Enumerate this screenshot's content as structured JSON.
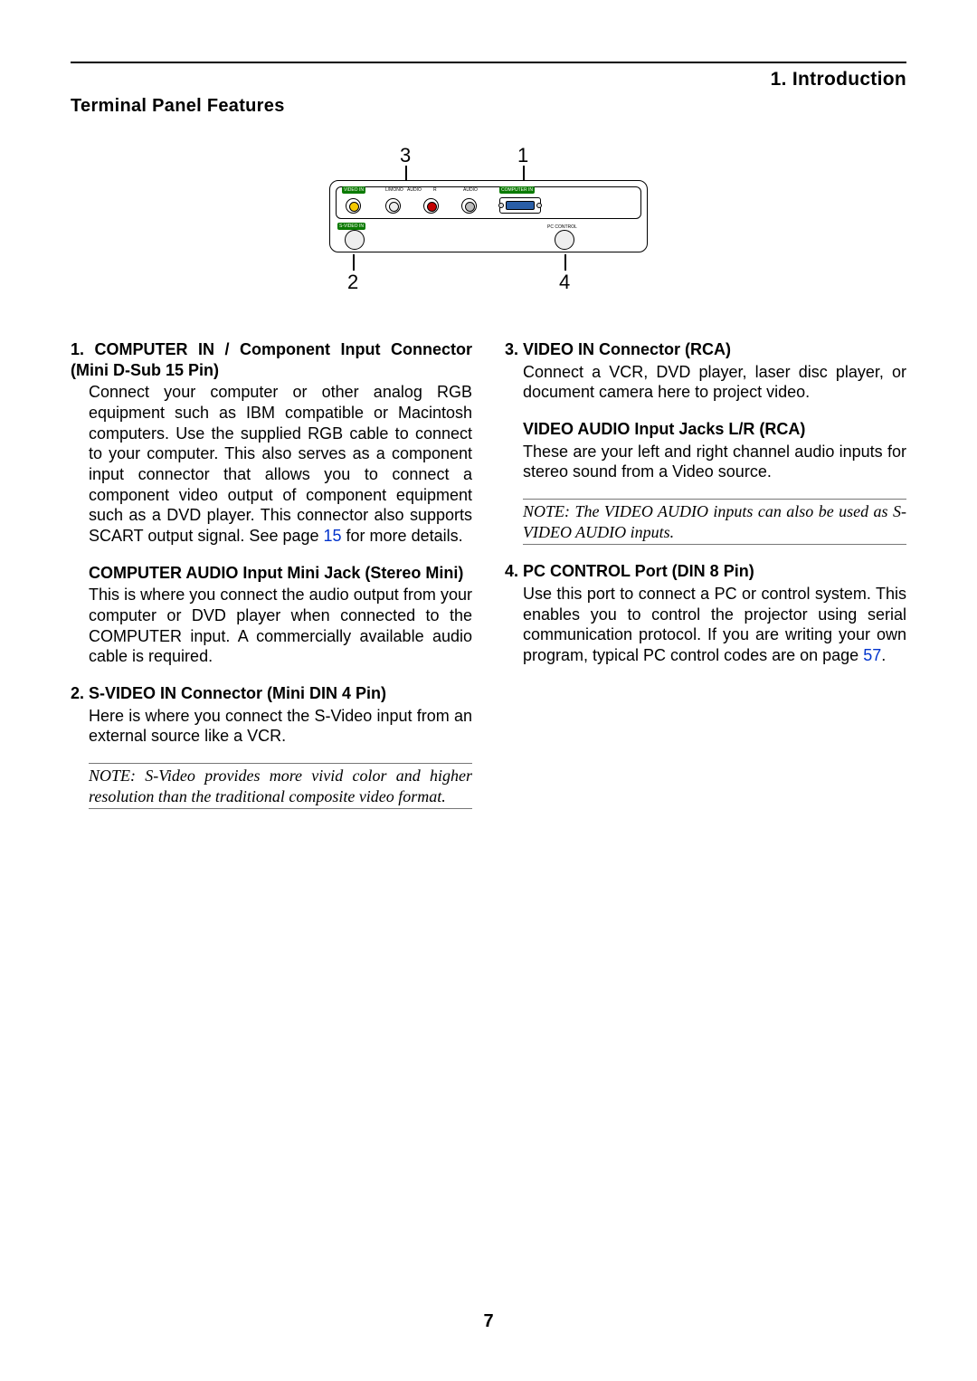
{
  "header": {
    "chapter": "1. Introduction",
    "section": "Terminal Panel Features"
  },
  "page_number": "7",
  "diagram": {
    "callouts": {
      "n1": "1",
      "n2": "2",
      "n3": "3",
      "n4": "4"
    },
    "labels": {
      "video_in": "VIDEO IN",
      "audio": "AUDIO",
      "lmono": "L/MONO",
      "r": "R",
      "audio2": "AUDIO",
      "computer_in": "COMPUTER IN",
      "s_video_in": "S-VIDEO IN",
      "pc_control": "PC CONTROL"
    }
  },
  "col1": {
    "t1": "1. COMPUTER IN / Component Input Connector (Mini D-Sub 15 Pin)",
    "p1a": "Connect your computer or other analog RGB equipment such as IBM compatible or Macintosh computers. Use the supplied RGB cable to connect to your computer. This also serves as a component input connector that allows you to connect a component video output of component equipment such as a DVD player. This connector also supports SCART output signal. See page ",
    "p1_link": "15",
    "p1b": " for more details.",
    "t2": "COMPUTER AUDIO Input Mini Jack (Stereo Mini)",
    "p2": "This is where you connect the audio output from your computer or DVD player when connected to the COMPUTER input. A commercially available audio cable is required.",
    "t3": "2. S-VIDEO IN Connector (Mini DIN 4 Pin)",
    "p3": "Here is where you connect the S-Video input from an external source like a VCR.",
    "note1": "NOTE: S-Video provides more vivid color and higher resolution than the traditional composite video format."
  },
  "col2": {
    "t1": "3. VIDEO IN Connector (RCA)",
    "p1": "Connect a VCR, DVD player, laser disc player, or document camera here to project video.",
    "t2": "VIDEO AUDIO Input Jacks L/R (RCA)",
    "p2": "These are your left and right channel audio inputs for stereo sound from a Video source.",
    "note1": "NOTE: The VIDEO AUDIO inputs can also be used as S-VIDEO AUDIO inputs.",
    "t3": "4. PC CONTROL Port (DIN 8 Pin)",
    "p3a": "Use this port to connect a PC or control system. This enables you to control the projector using serial communication protocol. If you are writing your own program, typical PC control codes are on page ",
    "p3_link": "57",
    "p3b": "."
  }
}
